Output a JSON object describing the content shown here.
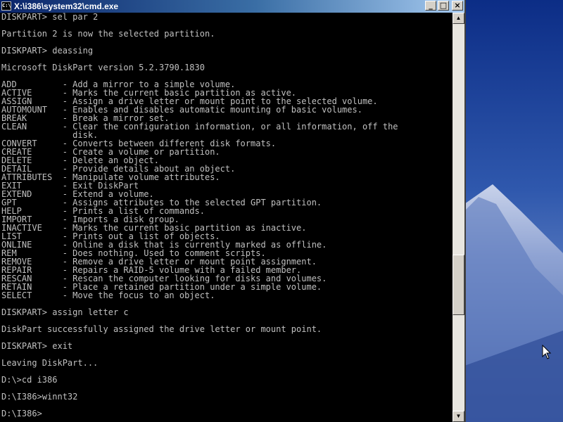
{
  "window": {
    "title": "X:\\i386\\system32\\cmd.exe",
    "icon_text": "C:\\",
    "minimize_icon": "minimize-icon",
    "maximize_icon": "maximize-icon",
    "close_icon": "close-icon"
  },
  "console": {
    "lines": [
      "DISKPART> sel par 2",
      "",
      "Partition 2 is now the selected partition.",
      "",
      "DISKPART> deassing",
      "",
      "Microsoft DiskPart version 5.2.3790.1830",
      "",
      "ADD         - Add a mirror to a simple volume.",
      "ACTIVE      - Marks the current basic partition as active.",
      "ASSIGN      - Assign a drive letter or mount point to the selected volume.",
      "AUTOMOUNT   - Enables and disables automatic mounting of basic volumes.",
      "BREAK       - Break a mirror set.",
      "CLEAN       - Clear the configuration information, or all information, off the",
      "              disk.",
      "CONVERT     - Converts between different disk formats.",
      "CREATE      - Create a volume or partition.",
      "DELETE      - Delete an object.",
      "DETAIL      - Provide details about an object.",
      "ATTRIBUTES  - Manipulate volume attributes.",
      "EXIT        - Exit DiskPart",
      "EXTEND      - Extend a volume.",
      "GPT         - Assigns attributes to the selected GPT partition.",
      "HELP        - Prints a list of commands.",
      "IMPORT      - Imports a disk group.",
      "INACTIVE    - Marks the current basic partition as inactive.",
      "LIST        - Prints out a list of objects.",
      "ONLINE      - Online a disk that is currently marked as offline.",
      "REM         - Does nothing. Used to comment scripts.",
      "REMOVE      - Remove a drive letter or mount point assignment.",
      "REPAIR      - Repairs a RAID-5 volume with a failed member.",
      "RESCAN      - Rescan the computer looking for disks and volumes.",
      "RETAIN      - Place a retained partition under a simple volume.",
      "SELECT      - Move the focus to an object.",
      "",
      "DISKPART> assign letter c",
      "",
      "DiskPart successfully assigned the drive letter or mount point.",
      "",
      "DISKPART> exit",
      "",
      "Leaving DiskPart...",
      "",
      "D:\\>cd i386",
      "",
      "D:\\I386>winnt32",
      "",
      "D:\\I386>"
    ]
  },
  "scrollbar": {
    "up_icon": "scroll-up-arrow-icon",
    "down_icon": "scroll-down-arrow-icon",
    "position_fraction": 0.62
  },
  "colors": {
    "console_bg": "#000000",
    "console_fg": "#c0c0c0",
    "titlebar_start": "#0a246a",
    "titlebar_end": "#a6caf0"
  }
}
